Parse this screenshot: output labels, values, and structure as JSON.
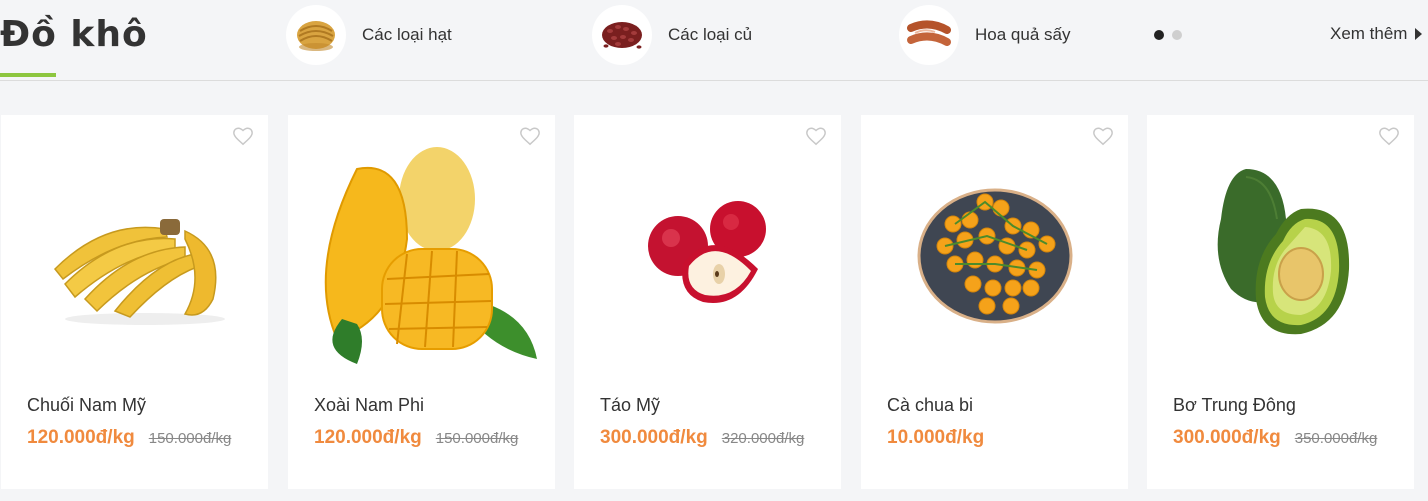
{
  "section": {
    "title": "Đồ khô",
    "accent": "#8dc63f"
  },
  "categories": [
    {
      "label": "Các loại hạt",
      "icon": "dried-noodles-icon"
    },
    {
      "label": "Các loại củ",
      "icon": "red-beans-icon"
    },
    {
      "label": "Hoa quả sấy",
      "icon": "sausage-icon"
    }
  ],
  "carousel": {
    "pages": 2,
    "active": 1
  },
  "more": {
    "label": "Xem thêm"
  },
  "products": [
    {
      "name": "Chuối Nam Mỹ",
      "price": "120.000đ/kg",
      "old_price": "150.000đ/kg",
      "image": "banana-image"
    },
    {
      "name": "Xoài Nam Phi",
      "price": "120.000đ/kg",
      "old_price": "150.000đ/kg",
      "image": "mango-image"
    },
    {
      "name": "Táo Mỹ",
      "price": "300.000đ/kg",
      "old_price": "320.000đ/kg",
      "image": "apple-image"
    },
    {
      "name": "Cà chua bi",
      "price": "10.000đ/kg",
      "old_price": "",
      "image": "cherry-tomato-image"
    },
    {
      "name": "Bơ Trung Đông",
      "price": "300.000đ/kg",
      "old_price": "350.000đ/kg",
      "image": "avocado-image"
    }
  ],
  "colors": {
    "price": "#f08a3e",
    "background": "#f4f5f7"
  }
}
